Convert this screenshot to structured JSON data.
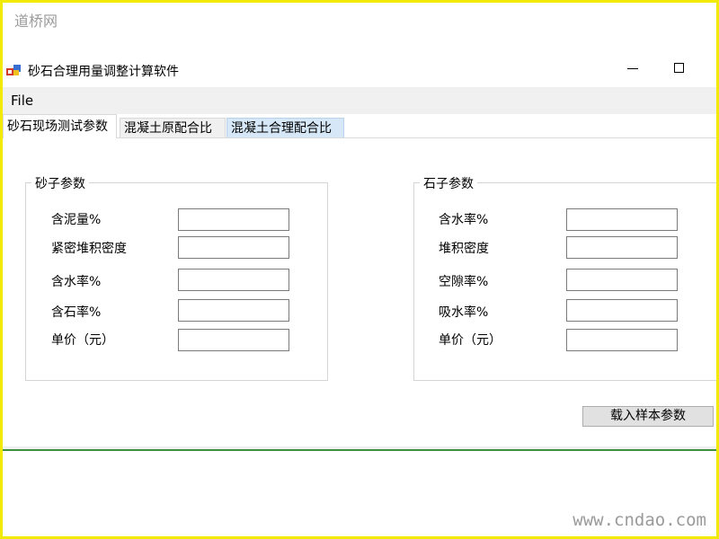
{
  "watermark": {
    "top": "道桥网",
    "bottom": "www.cndao.com"
  },
  "window": {
    "title": "砂石合理用量调整计算软件"
  },
  "menu": {
    "file": "File"
  },
  "tabs": [
    {
      "label": "砂石现场测试参数",
      "active": true
    },
    {
      "label": "混凝土原配合比",
      "active": false
    },
    {
      "label": "混凝土合理配合比",
      "active": false
    }
  ],
  "sand_group": {
    "title": "砂子参数",
    "fields": [
      {
        "label": "含泥量%",
        "value": ""
      },
      {
        "label": "紧密堆积密度",
        "value": ""
      },
      {
        "label": "含水率%",
        "value": ""
      },
      {
        "label": "含石率%",
        "value": ""
      },
      {
        "label": "单价（元）",
        "value": ""
      }
    ]
  },
  "stone_group": {
    "title": "石子参数",
    "fields": [
      {
        "label": "含水率%",
        "value": ""
      },
      {
        "label": "堆积密度",
        "value": ""
      },
      {
        "label": "空隙率%",
        "value": ""
      },
      {
        "label": "吸水率%",
        "value": ""
      },
      {
        "label": "单价（元）",
        "value": ""
      }
    ]
  },
  "actions": {
    "load_sample": "载入样本参数"
  },
  "colors": {
    "frame": "#f2ea00",
    "tab_highlight": "#d6e8f7",
    "status_line": "#3e8f3e"
  }
}
